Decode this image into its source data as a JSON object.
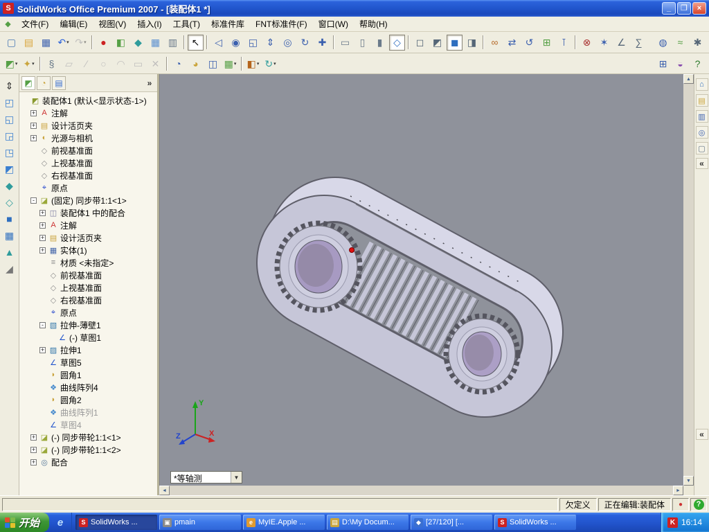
{
  "window": {
    "app_icon_letter": "S",
    "title": "SolidWorks Office Premium 2007 - [装配体1 *]",
    "controls": {
      "minimize": "_",
      "restore": "❐",
      "close": "×"
    }
  },
  "menu": {
    "doc_icon": "◆",
    "items": [
      "文件(F)",
      "编辑(E)",
      "视图(V)",
      "插入(I)",
      "工具(T)",
      "标准件库",
      "FNT标准件(F)",
      "窗口(W)",
      "帮助(H)"
    ]
  },
  "toolbar_main": {
    "icons": [
      {
        "name": "new-document",
        "glyph": "▢",
        "color": "#4a7ab5"
      },
      {
        "name": "open-document",
        "glyph": "▤",
        "color": "#d9a43a"
      },
      {
        "name": "save",
        "glyph": "▦",
        "color": "#3a5fae"
      },
      {
        "name": "undo",
        "glyph": "↶",
        "color": "#2b62d9",
        "caret": true
      },
      {
        "name": "redo",
        "glyph": "↷",
        "color": "#9a9aa2",
        "caret": true,
        "disabled": true
      },
      {
        "sep": true
      },
      {
        "name": "record-macro",
        "glyph": "●",
        "color": "#cc2222"
      },
      {
        "name": "edit-component",
        "glyph": "◧",
        "color": "#56a046"
      },
      {
        "name": "rebuild",
        "glyph": "◆",
        "color": "#2f9c9c"
      },
      {
        "name": "design-table",
        "glyph": "▦",
        "color": "#5a8fd0"
      },
      {
        "name": "print",
        "glyph": "▥",
        "color": "#667788"
      },
      {
        "sep": true
      },
      {
        "name": "select",
        "glyph": "↖",
        "color": "#111111",
        "pressed": true
      },
      {
        "sep": true
      },
      {
        "name": "zoom-previous",
        "glyph": "◁",
        "color": "#3a5fae"
      },
      {
        "name": "zoom-to-fit",
        "glyph": "◉",
        "color": "#3a5fae"
      },
      {
        "name": "zoom-to-area",
        "glyph": "◱",
        "color": "#3a5fae"
      },
      {
        "name": "zoom-in-out",
        "glyph": "⇕",
        "color": "#3a5fae"
      },
      {
        "name": "zoom-to-selection",
        "glyph": "◎",
        "color": "#3a5fae"
      },
      {
        "name": "rotate-view",
        "glyph": "↻",
        "color": "#3a5fae"
      },
      {
        "name": "pan",
        "glyph": "✚",
        "color": "#3a5fae"
      },
      {
        "sep": true
      },
      {
        "name": "view-front",
        "glyph": "▭",
        "color": "#6a7a8a"
      },
      {
        "name": "view-top",
        "glyph": "▯",
        "color": "#6a7a8a"
      },
      {
        "name": "view-left",
        "glyph": "▮",
        "color": "#6a7a8a"
      },
      {
        "name": "view-isometric",
        "glyph": "◇",
        "color": "#2f6fbf",
        "pressed": true
      },
      {
        "sep": true
      },
      {
        "name": "wireframe",
        "glyph": "◻",
        "color": "#556677"
      },
      {
        "name": "hidden-lines-visible",
        "glyph": "◩",
        "color": "#556677"
      },
      {
        "name": "shaded-with-edges",
        "glyph": "◼",
        "color": "#2f6fbf",
        "pressed": true
      },
      {
        "name": "section-view",
        "glyph": "◨",
        "color": "#556677"
      },
      {
        "sep": true
      },
      {
        "name": "mate",
        "glyph": "∞",
        "color": "#b56a2a"
      },
      {
        "name": "move-component",
        "glyph": "⇄",
        "color": "#3a5fae"
      },
      {
        "name": "rotate-component",
        "glyph": "↺",
        "color": "#3a5fae"
      },
      {
        "name": "insert-components",
        "glyph": "⊞",
        "color": "#56a046"
      },
      {
        "name": "smart-fasteners",
        "glyph": "⊺",
        "color": "#3a5fae"
      },
      {
        "sep": true
      },
      {
        "name": "interference-detection",
        "glyph": "⊗",
        "color": "#aa3333"
      },
      {
        "name": "exploded-view",
        "glyph": "✶",
        "color": "#3a5fae"
      },
      {
        "name": "measure",
        "glyph": "∠",
        "color": "#556677"
      },
      {
        "name": "mass-properties",
        "glyph": "∑",
        "color": "#556677"
      }
    ]
  },
  "toolbar_main_right": {
    "icons": [
      {
        "name": "edrawings-publish",
        "glyph": "◍",
        "color": "#3a5fae"
      },
      {
        "name": "curvature",
        "glyph": "≈",
        "color": "#56a046"
      },
      {
        "name": "options",
        "glyph": "✱",
        "color": "#556677"
      }
    ]
  },
  "toolbar_assembly": {
    "icons": [
      {
        "name": "insert-component",
        "glyph": "◩",
        "color": "#56a046",
        "caret": true
      },
      {
        "name": "smart-tools",
        "glyph": "✦",
        "color": "#caa53d",
        "caret": true
      },
      {
        "sep": true
      },
      {
        "name": "attachments",
        "glyph": "§",
        "color": "#667788"
      },
      {
        "name": "sketch",
        "glyph": "▱",
        "color": "#9a9aa2",
        "disabled": true
      },
      {
        "name": "line",
        "glyph": "∕",
        "color": "#9a9aa2",
        "disabled": true
      },
      {
        "name": "circle",
        "glyph": "○",
        "color": "#9a9aa2",
        "disabled": true
      },
      {
        "name": "arc",
        "glyph": "◠",
        "color": "#9a9aa2",
        "disabled": true
      },
      {
        "name": "rectangle",
        "glyph": "▭",
        "color": "#9a9aa2",
        "disabled": true
      },
      {
        "name": "trim-entities",
        "glyph": "✕",
        "color": "#9a9aa2",
        "disabled": true
      },
      {
        "sep": true
      },
      {
        "name": "convert-entities",
        "glyph": "◔",
        "color": "#3a5fae"
      },
      {
        "name": "offset-entities",
        "glyph": "◕",
        "color": "#caa53d"
      },
      {
        "name": "mirror-entities",
        "glyph": "◫",
        "color": "#3a5fae"
      },
      {
        "name": "linear-pattern",
        "glyph": "▦",
        "color": "#56a046",
        "caret": true
      },
      {
        "sep": true
      },
      {
        "name": "appearance",
        "glyph": "◧",
        "color": "#b5651d",
        "caret": true
      },
      {
        "name": "standard-views",
        "glyph": "↻",
        "color": "#2f9c9c",
        "caret": true
      }
    ]
  },
  "toolbar_assembly_right": {
    "icons": [
      {
        "name": "toolbox",
        "glyph": "⊞",
        "color": "#3a5fae"
      },
      {
        "name": "photoworks",
        "glyph": "◒",
        "color": "#8a4fae"
      },
      {
        "name": "help",
        "glyph": "?",
        "color": "#2a7a2a"
      }
    ]
  },
  "left_toolbar": {
    "icons": [
      {
        "name": "pushpin",
        "glyph": "⇕",
        "color": "#333333"
      },
      {
        "name": "insert-component-side",
        "glyph": "◰",
        "color": "#3a7fd0"
      },
      {
        "name": "make-assembly",
        "glyph": "◱",
        "color": "#3a7fd0"
      },
      {
        "name": "edit-part",
        "glyph": "◲",
        "color": "#3a7fd0"
      },
      {
        "name": "hide-show-component",
        "glyph": "◳",
        "color": "#3a7fd0"
      },
      {
        "name": "change-transparency",
        "glyph": "◩",
        "color": "#3a7fd0"
      },
      {
        "name": "move-component-side",
        "glyph": "◆",
        "color": "#2f9c9c"
      },
      {
        "name": "rotate-component-side",
        "glyph": "◇",
        "color": "#2f9c9c"
      },
      {
        "name": "mate-side",
        "glyph": "■",
        "color": "#2f6fbf"
      },
      {
        "name": "component-pattern",
        "glyph": "▦",
        "color": "#2f6fbf"
      },
      {
        "name": "exploded-view-side",
        "glyph": "▲",
        "color": "#2f9c9c"
      },
      {
        "name": "section-side",
        "glyph": "◢",
        "color": "#777777"
      }
    ]
  },
  "right_strip": {
    "icons": [
      {
        "name": "home",
        "glyph": "⌂",
        "color": "#2f6fbf"
      },
      {
        "name": "design-library",
        "glyph": "▤",
        "color": "#caa53d"
      },
      {
        "name": "file-explorer",
        "glyph": "▥",
        "color": "#3a5fae"
      },
      {
        "name": "search",
        "glyph": "◎",
        "color": "#3a5fae"
      },
      {
        "name": "document-preview",
        "glyph": "▢",
        "color": "#667788"
      }
    ],
    "collapse_chevron": "«",
    "bottom_chevron": "«"
  },
  "feature_tree": {
    "tabs": [
      {
        "name": "featuremanager-tab",
        "glyph": "◩",
        "color": "#56a046"
      },
      {
        "name": "propertymanager-tab",
        "glyph": "◔",
        "color": "#caa53d"
      },
      {
        "name": "configurationmanager-tab",
        "glyph": "▤",
        "color": "#3a6fd0"
      }
    ],
    "panel_chevron": "»",
    "icon_map": {
      "assembly": {
        "glyph": "◩",
        "color": "#8a9a2f"
      },
      "annotations": {
        "glyph": "A",
        "color": "#cc3333"
      },
      "binder": {
        "glyph": "▤",
        "color": "#c9a23c"
      },
      "lights": {
        "glyph": "◐",
        "color": "#c9a23c"
      },
      "plane": {
        "glyph": "◇",
        "color": "#8f8f8f"
      },
      "origin": {
        "glyph": "⌖",
        "color": "#2244cc"
      },
      "part": {
        "glyph": "◪",
        "color": "#9aa83a"
      },
      "mates-folder": {
        "glyph": "◫",
        "color": "#7a7aa0"
      },
      "solids": {
        "glyph": "▦",
        "color": "#4466aa"
      },
      "material": {
        "glyph": "≡",
        "color": "#888888"
      },
      "extrude-thin": {
        "glyph": "▧",
        "color": "#3377aa"
      },
      "sketch": {
        "glyph": "∠",
        "color": "#2255cc"
      },
      "extrude": {
        "glyph": "▨",
        "color": "#3377aa"
      },
      "fillet": {
        "glyph": "◗",
        "color": "#c9a23c"
      },
      "curve-pattern": {
        "glyph": "❖",
        "color": "#4488cc"
      },
      "mates": {
        "glyph": "◎",
        "color": "#557799"
      }
    },
    "items": [
      {
        "level": 0,
        "expand": "none",
        "icon": "assembly",
        "label": "装配体1  (默认<显示状态-1>)"
      },
      {
        "level": 1,
        "expand": "plus",
        "icon": "annotations",
        "label": "注解"
      },
      {
        "level": 1,
        "expand": "plus",
        "icon": "binder",
        "label": "设计活页夹"
      },
      {
        "level": 1,
        "expand": "plus",
        "icon": "lights",
        "label": "光源与相机"
      },
      {
        "level": 1,
        "expand": "none",
        "icon": "plane",
        "label": "前视基准面"
      },
      {
        "level": 1,
        "expand": "none",
        "icon": "plane",
        "label": "上视基准面"
      },
      {
        "level": 1,
        "expand": "none",
        "icon": "plane",
        "label": "右视基准面"
      },
      {
        "level": 1,
        "expand": "none",
        "icon": "origin",
        "label": "原点"
      },
      {
        "level": 1,
        "expand": "minus",
        "icon": "part",
        "label": "(固定) 同步带1:1<1>"
      },
      {
        "level": 2,
        "expand": "plus",
        "icon": "mates-folder",
        "label": "装配体1 中的配合"
      },
      {
        "level": 2,
        "expand": "plus",
        "icon": "annotations",
        "label": "注解"
      },
      {
        "level": 2,
        "expand": "plus",
        "icon": "binder",
        "label": "设计活页夹"
      },
      {
        "level": 2,
        "expand": "plus",
        "icon": "solids",
        "label": "实体(1)"
      },
      {
        "level": 2,
        "expand": "none",
        "icon": "material",
        "label": "材质 <未指定>"
      },
      {
        "level": 2,
        "expand": "none",
        "icon": "plane",
        "label": "前视基准面"
      },
      {
        "level": 2,
        "expand": "none",
        "icon": "plane",
        "label": "上视基准面"
      },
      {
        "level": 2,
        "expand": "none",
        "icon": "plane",
        "label": "右视基准面"
      },
      {
        "level": 2,
        "expand": "none",
        "icon": "origin",
        "label": "原点"
      },
      {
        "level": 2,
        "expand": "minus",
        "icon": "extrude-thin",
        "label": "拉伸-薄壁1"
      },
      {
        "level": 3,
        "expand": "none",
        "icon": "sketch",
        "label": "(-) 草图1"
      },
      {
        "level": 2,
        "expand": "plus",
        "icon": "extrude",
        "label": "拉伸1"
      },
      {
        "level": 2,
        "expand": "none",
        "icon": "sketch",
        "label": "草图5"
      },
      {
        "level": 2,
        "expand": "none",
        "icon": "fillet",
        "label": "圆角1"
      },
      {
        "level": 2,
        "expand": "none",
        "icon": "curve-pattern",
        "label": "曲线阵列4"
      },
      {
        "level": 2,
        "expand": "none",
        "icon": "fillet",
        "label": "圆角2"
      },
      {
        "level": 2,
        "expand": "none",
        "icon": "curve-pattern",
        "label": "曲线阵列1",
        "grayed": true
      },
      {
        "level": 2,
        "expand": "none",
        "icon": "sketch",
        "label": "草图4",
        "grayed": true
      },
      {
        "level": 1,
        "expand": "plus",
        "icon": "part",
        "label": "(-) 同步带轮1:1<1>"
      },
      {
        "level": 1,
        "expand": "plus",
        "icon": "part",
        "label": "(-) 同步带轮1:1<2>"
      },
      {
        "level": 1,
        "expand": "plus",
        "icon": "mates",
        "label": "配合"
      }
    ]
  },
  "viewport": {
    "view_selector": "*等轴测",
    "triad": {
      "x": "X",
      "y": "Y",
      "z": "Z"
    }
  },
  "status_bar": {
    "definition": "欠定义",
    "editing": "正在编辑:装配体",
    "rebuild_indicator": "●",
    "help_glyph": "?"
  },
  "taskbar": {
    "start_label": "开始",
    "quick_launch": [
      {
        "name": "internet-explorer",
        "glyph": "e"
      }
    ],
    "buttons": [
      {
        "label": "SolidWorks ...",
        "icon_glyph": "S",
        "icon_color": "#cc2222",
        "active": true
      },
      {
        "label": "pmain",
        "icon_glyph": "▣",
        "icon_color": "#888888"
      },
      {
        "label": "MyIE.Apple ...",
        "icon_glyph": "e",
        "icon_color": "#e09a2f"
      },
      {
        "label": "D:\\My Docum...",
        "icon_glyph": "▤",
        "icon_color": "#caa53d"
      },
      {
        "label": "[27/120] [...",
        "icon_glyph": "◆",
        "icon_color": "#3a6fd0"
      },
      {
        "label": "SolidWorks ...",
        "icon_glyph": "S",
        "icon_color": "#cc2222"
      }
    ],
    "tray": {
      "k_icon": "K",
      "clock": "16:14"
    }
  }
}
